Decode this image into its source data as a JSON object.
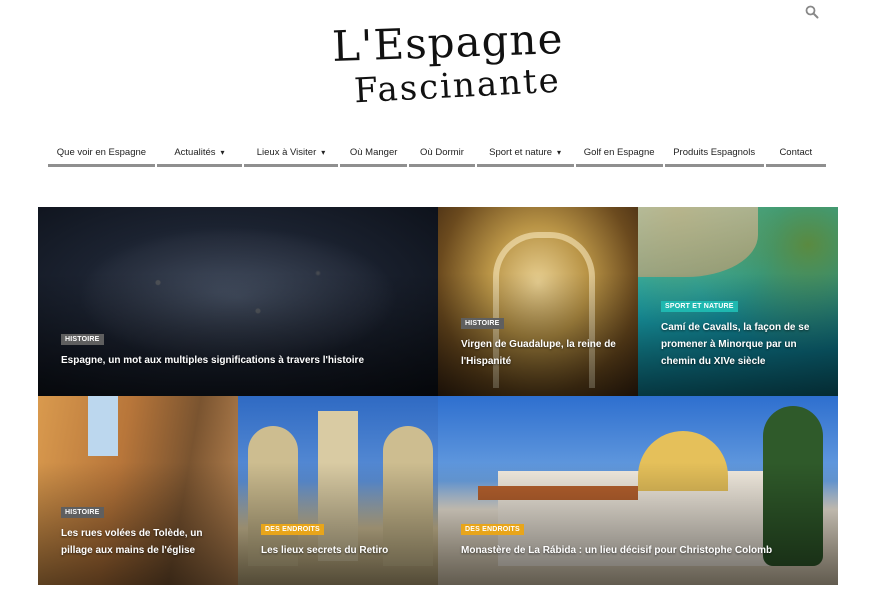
{
  "site": {
    "logo_line1": "L'Espagne",
    "logo_line2": "Fascinante"
  },
  "header": {
    "search_icon": "search-icon"
  },
  "nav": {
    "items": [
      {
        "label": "Que voir en Espagne",
        "dropdown": false
      },
      {
        "label": "Actualités",
        "dropdown": true
      },
      {
        "label": "Lieux à Visiter",
        "dropdown": true
      },
      {
        "label": "Où Manger",
        "dropdown": false
      },
      {
        "label": "Où Dormir",
        "dropdown": false
      },
      {
        "label": "Sport et nature",
        "dropdown": true
      },
      {
        "label": "Golf en Espagne",
        "dropdown": false
      },
      {
        "label": "Produits Espagnols",
        "dropdown": false
      },
      {
        "label": "Contact",
        "dropdown": false
      }
    ],
    "chevron": "▾"
  },
  "colors": {
    "badge_histoire": "#5f5f5f",
    "badge_sport": "#1fb8b0",
    "badge_endroits": "#e8a51a",
    "nav_underline": "#8f8f8f"
  },
  "articles": [
    {
      "category": "Histoire",
      "title": "Espagne, un mot aux multiples significations à travers l'histoire"
    },
    {
      "category": "Histoire",
      "title": "Virgen de Guadalupe, la reine de l'Hispanité"
    },
    {
      "category": "Sport et nature",
      "title": "Camí de Cavalls, la façon de se promener à Minorque par un chemin du XIVe siècle"
    },
    {
      "category": "Histoire",
      "title": "Les rues volées de Tolède, un pillage aux mains de l'église"
    },
    {
      "category": "Des endroits",
      "title": "Les lieux secrets du Retiro"
    },
    {
      "category": "Des endroits",
      "title": "Monastère de La Rábida : un lieu décisif pour Christophe Colomb"
    }
  ]
}
